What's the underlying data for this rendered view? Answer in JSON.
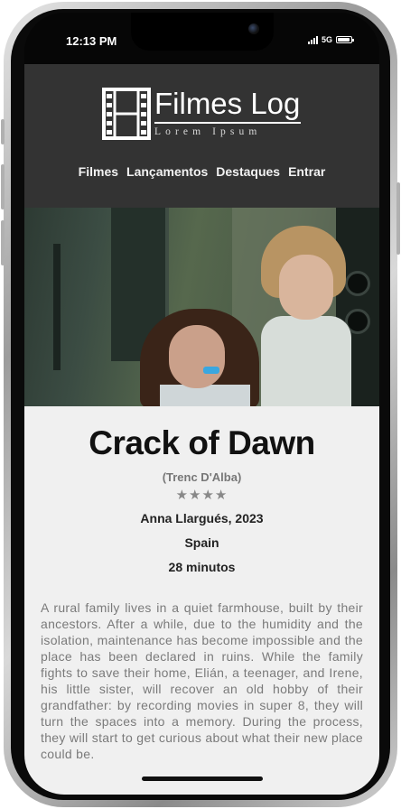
{
  "status_bar": {
    "time": "12:13 PM",
    "network": "5G",
    "battery_level": 0.9
  },
  "header": {
    "logo_title": "Filmes Log",
    "logo_subtitle": "Lorem Ipsum",
    "nav": [
      "Filmes",
      "Lançamentos",
      "Destaques",
      "Entrar"
    ],
    "background_color": "#333333"
  },
  "hero": {
    "image_alt": "Two children brushing their teeth in a green-toned room"
  },
  "movie": {
    "title": "Crack of Dawn",
    "original_title": "(Trenc D'Alba)",
    "rating_stars": "★★★★",
    "rating": 4,
    "director_year": "Anna Llargués, 2023",
    "country": "Spain",
    "duration": "28 minutos",
    "synopsis": "A rural family lives in a quiet farmhouse, built by their ancestors. After a while, due to the humidity and the isolation, maintenance has become impossible and the place has been declared in ruins. While the family fights to save their home, Elián, a teenager, and Irene, his little sister, will recover an old hobby of their grandfather: by recording movies in super 8, they will turn the spaces into a memory. During the process, they will start to get curious about what their new place could be."
  }
}
